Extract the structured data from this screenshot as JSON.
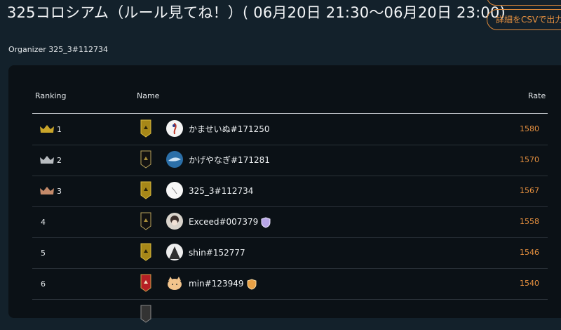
{
  "header": {
    "title": "325コロシアム（ルール見てね！）( 06月20日 21:30〜06月20日 23:00)",
    "csv_button_label": "詳細をCSVで出力",
    "organizer": "Organizer 325_3#112734"
  },
  "table": {
    "columns": [
      "Ranking",
      "Name",
      "Rate"
    ],
    "rows": [
      {
        "rank": "1",
        "crown": "gold-crown-icon",
        "badge": "gold-emblem",
        "name": "かませいぬ#171250",
        "rate": "1580"
      },
      {
        "rank": "2",
        "crown": "silver-crown-icon",
        "badge": "black-emblem",
        "name": "かげやなぎ#171281",
        "rate": "1570"
      },
      {
        "rank": "3",
        "crown": "bronze-crown-icon",
        "badge": "gold-emblem",
        "name": "325_3#112734",
        "rate": "1567"
      },
      {
        "rank": "4",
        "crown": "",
        "badge": "black-emblem",
        "name": "Exceed#007379",
        "shield": "purple-shield-icon",
        "rate": "1558"
      },
      {
        "rank": "5",
        "crown": "",
        "badge": "gold-emblem",
        "name": "shin#152777",
        "rate": "1546"
      },
      {
        "rank": "6",
        "crown": "",
        "badge": "red-emblem",
        "name": "min#123949",
        "shield": "orange-shield-icon",
        "rate": "1540"
      }
    ]
  },
  "colors": {
    "background": "#13212b",
    "panel": "#0b1116",
    "accent": "#e8913f",
    "gold": "#b8961e",
    "silver": "#b8bcc0",
    "bronze": "#c48a6a"
  }
}
